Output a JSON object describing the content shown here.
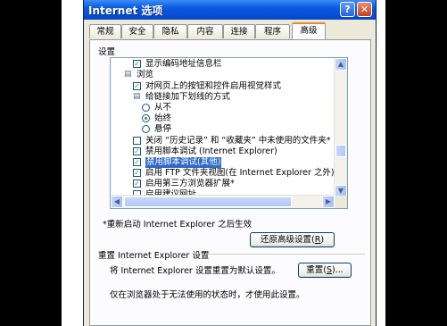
{
  "window": {
    "title": "Internet 选项",
    "help_glyph": "?",
    "close_glyph": "✕"
  },
  "tabs": [
    {
      "label": "常规"
    },
    {
      "label": "安全"
    },
    {
      "label": "隐私"
    },
    {
      "label": "内容"
    },
    {
      "label": "连接"
    },
    {
      "label": "程序"
    },
    {
      "label": "高级",
      "active": true
    }
  ],
  "settings_label": "设置",
  "tree": [
    {
      "type": "checkbox",
      "checked": true,
      "label": "显示编码地址信息栏"
    },
    {
      "type": "folder",
      "label": "浏览"
    },
    {
      "type": "checkbox",
      "checked": true,
      "label": "对网页上的按钮和控件启用视觉样式"
    },
    {
      "type": "folder",
      "label": "给链接加下划线的方式"
    },
    {
      "type": "radio",
      "checked": false,
      "label": "从不"
    },
    {
      "type": "radio",
      "checked": true,
      "label": "始终"
    },
    {
      "type": "radio",
      "checked": false,
      "label": "悬停"
    },
    {
      "type": "checkbox",
      "checked": false,
      "label": "关闭 “历史记录” 和 “收藏夹” 中未使用的文件夹*"
    },
    {
      "type": "checkbox",
      "checked": true,
      "label": "禁用脚本调试 (Internet Explorer)"
    },
    {
      "type": "checkbox",
      "checked": true,
      "label": "禁用脚本调试(其他)",
      "selected": true
    },
    {
      "type": "checkbox",
      "checked": true,
      "label": "启用 FTP 文件夹视图(在 Internet Explorer 之外)"
    },
    {
      "type": "checkbox",
      "checked": true,
      "label": "启用第三方浏览器扩展*"
    },
    {
      "type": "checkbox",
      "checked": false,
      "label": "启用建议网址"
    }
  ],
  "restart_note": "*重新启动 Internet Explorer 之后生效",
  "restore_button": {
    "label": "还原高级设置",
    "accel": "R"
  },
  "reset_group": {
    "title": "重置 Internet Explorer 设置",
    "description": "将 Internet Explorer 设置重置为默认设置。",
    "button_label": "重置",
    "button_accel": "S",
    "button_suffix": "..."
  },
  "footer_note": "仅在浏览器处于无法使用的状态时，才使用此设置。",
  "colors": {
    "title_bar": "#0a5ae0",
    "selection": "#316ac5",
    "check": "#21a121",
    "close": "#c4411b",
    "active_tab_accent": "#e68b2c"
  }
}
